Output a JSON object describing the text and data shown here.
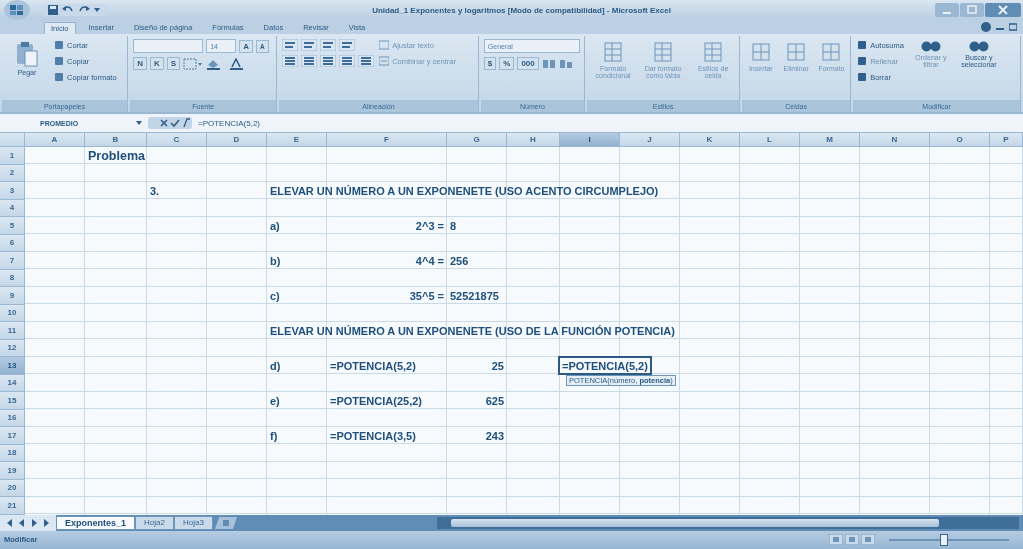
{
  "window": {
    "title": "Unidad_1 Exponentes y logaritmos [Modo de compatibilidad] - Microsoft Excel"
  },
  "tabs": [
    {
      "label": "Inicio",
      "selected": true
    },
    {
      "label": "Insertar",
      "selected": false
    },
    {
      "label": "Diseño de página",
      "selected": false
    },
    {
      "label": "Fórmulas",
      "selected": false
    },
    {
      "label": "Datos",
      "selected": false
    },
    {
      "label": "Revisar",
      "selected": false
    },
    {
      "label": "Vista",
      "selected": false
    }
  ],
  "ribbon": {
    "clipboard": {
      "paste": "Pegar",
      "items": [
        "Cortar",
        "Copiar",
        "Copiar formato"
      ],
      "label": "Portapapeles"
    },
    "font": {
      "size": "14",
      "grow": "A",
      "shrink": "A",
      "styles": [
        "N",
        "K",
        "S"
      ],
      "label": "Fuente"
    },
    "alignment": {
      "wrap": "Ajustar texto",
      "merge": "Combinar y centrar",
      "label": "Alineación"
    },
    "number": {
      "format": "General",
      "symbols": [
        "$",
        "%",
        "000"
      ],
      "label": "Número"
    },
    "styles": {
      "items": [
        "Formato condicional",
        "Dar formato como tabla",
        "Estilos de celda"
      ],
      "label": "Estilos"
    },
    "cells": {
      "items": [
        "Insertar",
        "Eliminar",
        "Formato"
      ],
      "label": "Celdas"
    },
    "editing": {
      "items": [
        "Autosuma",
        "Rellenar",
        "Borrar"
      ],
      "big": [
        "Ordenar y filtrar",
        "Buscar y seleccionar"
      ],
      "label": "Modificar"
    }
  },
  "formula_bar": {
    "name_box": "PROMEDIO",
    "formula": "=POTENCIA(5,2)"
  },
  "sheet": {
    "columns": [
      {
        "label": "A",
        "selected": false
      },
      {
        "label": "B",
        "selected": false
      },
      {
        "label": "C",
        "selected": false
      },
      {
        "label": "D",
        "selected": false
      },
      {
        "label": "E",
        "selected": false
      },
      {
        "label": "F",
        "selected": false
      },
      {
        "label": "G",
        "selected": false
      },
      {
        "label": "H",
        "selected": false
      },
      {
        "label": "I",
        "selected": true
      },
      {
        "label": "J",
        "selected": false
      },
      {
        "label": "K",
        "selected": false
      },
      {
        "label": "L",
        "selected": false
      },
      {
        "label": "M",
        "selected": false
      },
      {
        "label": "N",
        "selected": false
      },
      {
        "label": "O",
        "selected": false
      },
      {
        "label": "P",
        "selected": false
      }
    ],
    "rows": [
      {
        "number": "1",
        "selected": false,
        "cells": {
          "B": {
            "text": "Problema",
            "kind": "title"
          }
        }
      },
      {
        "number": "2",
        "selected": false
      },
      {
        "number": "3",
        "selected": false,
        "cells": {
          "C": {
            "text": "3.",
            "kind": "text"
          },
          "E": {
            "text": "ELEVAR UN NÚMERO A UN EXPONENETE (USO ACENTO CIRCUMPLEJO)",
            "kind": "text"
          }
        }
      },
      {
        "number": "4",
        "selected": false
      },
      {
        "number": "5",
        "selected": false,
        "cells": {
          "E": {
            "text": "a)",
            "kind": "text"
          },
          "F": {
            "text": "2^3 =",
            "kind": "right"
          },
          "G": {
            "text": "8",
            "kind": "text"
          }
        }
      },
      {
        "number": "6",
        "selected": false
      },
      {
        "number": "7",
        "selected": false,
        "cells": {
          "E": {
            "text": "b)",
            "kind": "text"
          },
          "F": {
            "text": "4^4 =",
            "kind": "right"
          },
          "G": {
            "text": "256",
            "kind": "text"
          }
        }
      },
      {
        "number": "8",
        "selected": false
      },
      {
        "number": "9",
        "selected": false,
        "cells": {
          "E": {
            "text": "c)",
            "kind": "text"
          },
          "F": {
            "text": "35^5 =",
            "kind": "right"
          },
          "G": {
            "text": "52521875",
            "kind": "text"
          }
        }
      },
      {
        "number": "10",
        "selected": false
      },
      {
        "number": "11",
        "selected": false,
        "cells": {
          "E": {
            "text": "ELEVAR UN NÚMERO A UN EXPONENETE (USO DE LA FUNCIÓN POTENCIA)",
            "kind": "text"
          }
        }
      },
      {
        "number": "12",
        "selected": false
      },
      {
        "number": "13",
        "selected": true,
        "cells": {
          "E": {
            "text": "d)",
            "kind": "text"
          },
          "F": {
            "text": "=POTENCIA(5,2)",
            "kind": "text"
          },
          "G": {
            "text": "25",
            "kind": "right"
          },
          "I": {
            "text": "=POTENCIA(5,2)",
            "kind": "editing",
            "tooltip": "POTENCIA(número, **potencia**)"
          }
        }
      },
      {
        "number": "14",
        "selected": false
      },
      {
        "number": "15",
        "selected": false,
        "cells": {
          "E": {
            "text": "e)",
            "kind": "text"
          },
          "F": {
            "text": "=POTENCIA(25,2)",
            "kind": "text"
          },
          "G": {
            "text": "625",
            "kind": "right"
          }
        }
      },
      {
        "number": "16",
        "selected": false
      },
      {
        "number": "17",
        "selected": false,
        "cells": {
          "E": {
            "text": "f)",
            "kind": "text"
          },
          "F": {
            "text": "=POTENCIA(3,5)",
            "kind": "text"
          },
          "G": {
            "text": "243",
            "kind": "right"
          }
        }
      },
      {
        "number": "18",
        "selected": false
      },
      {
        "number": "19",
        "selected": false
      },
      {
        "number": "20",
        "selected": false
      },
      {
        "number": "21",
        "selected": false
      }
    ]
  },
  "sheet_tabs": [
    {
      "label": "Exponentes_1",
      "selected": true
    },
    {
      "label": "Hoja2",
      "selected": false
    },
    {
      "label": "Hoja3",
      "selected": false
    }
  ],
  "status_bar": {
    "mode": "Modificar",
    "zoom": {
      "level": 0.45
    }
  }
}
